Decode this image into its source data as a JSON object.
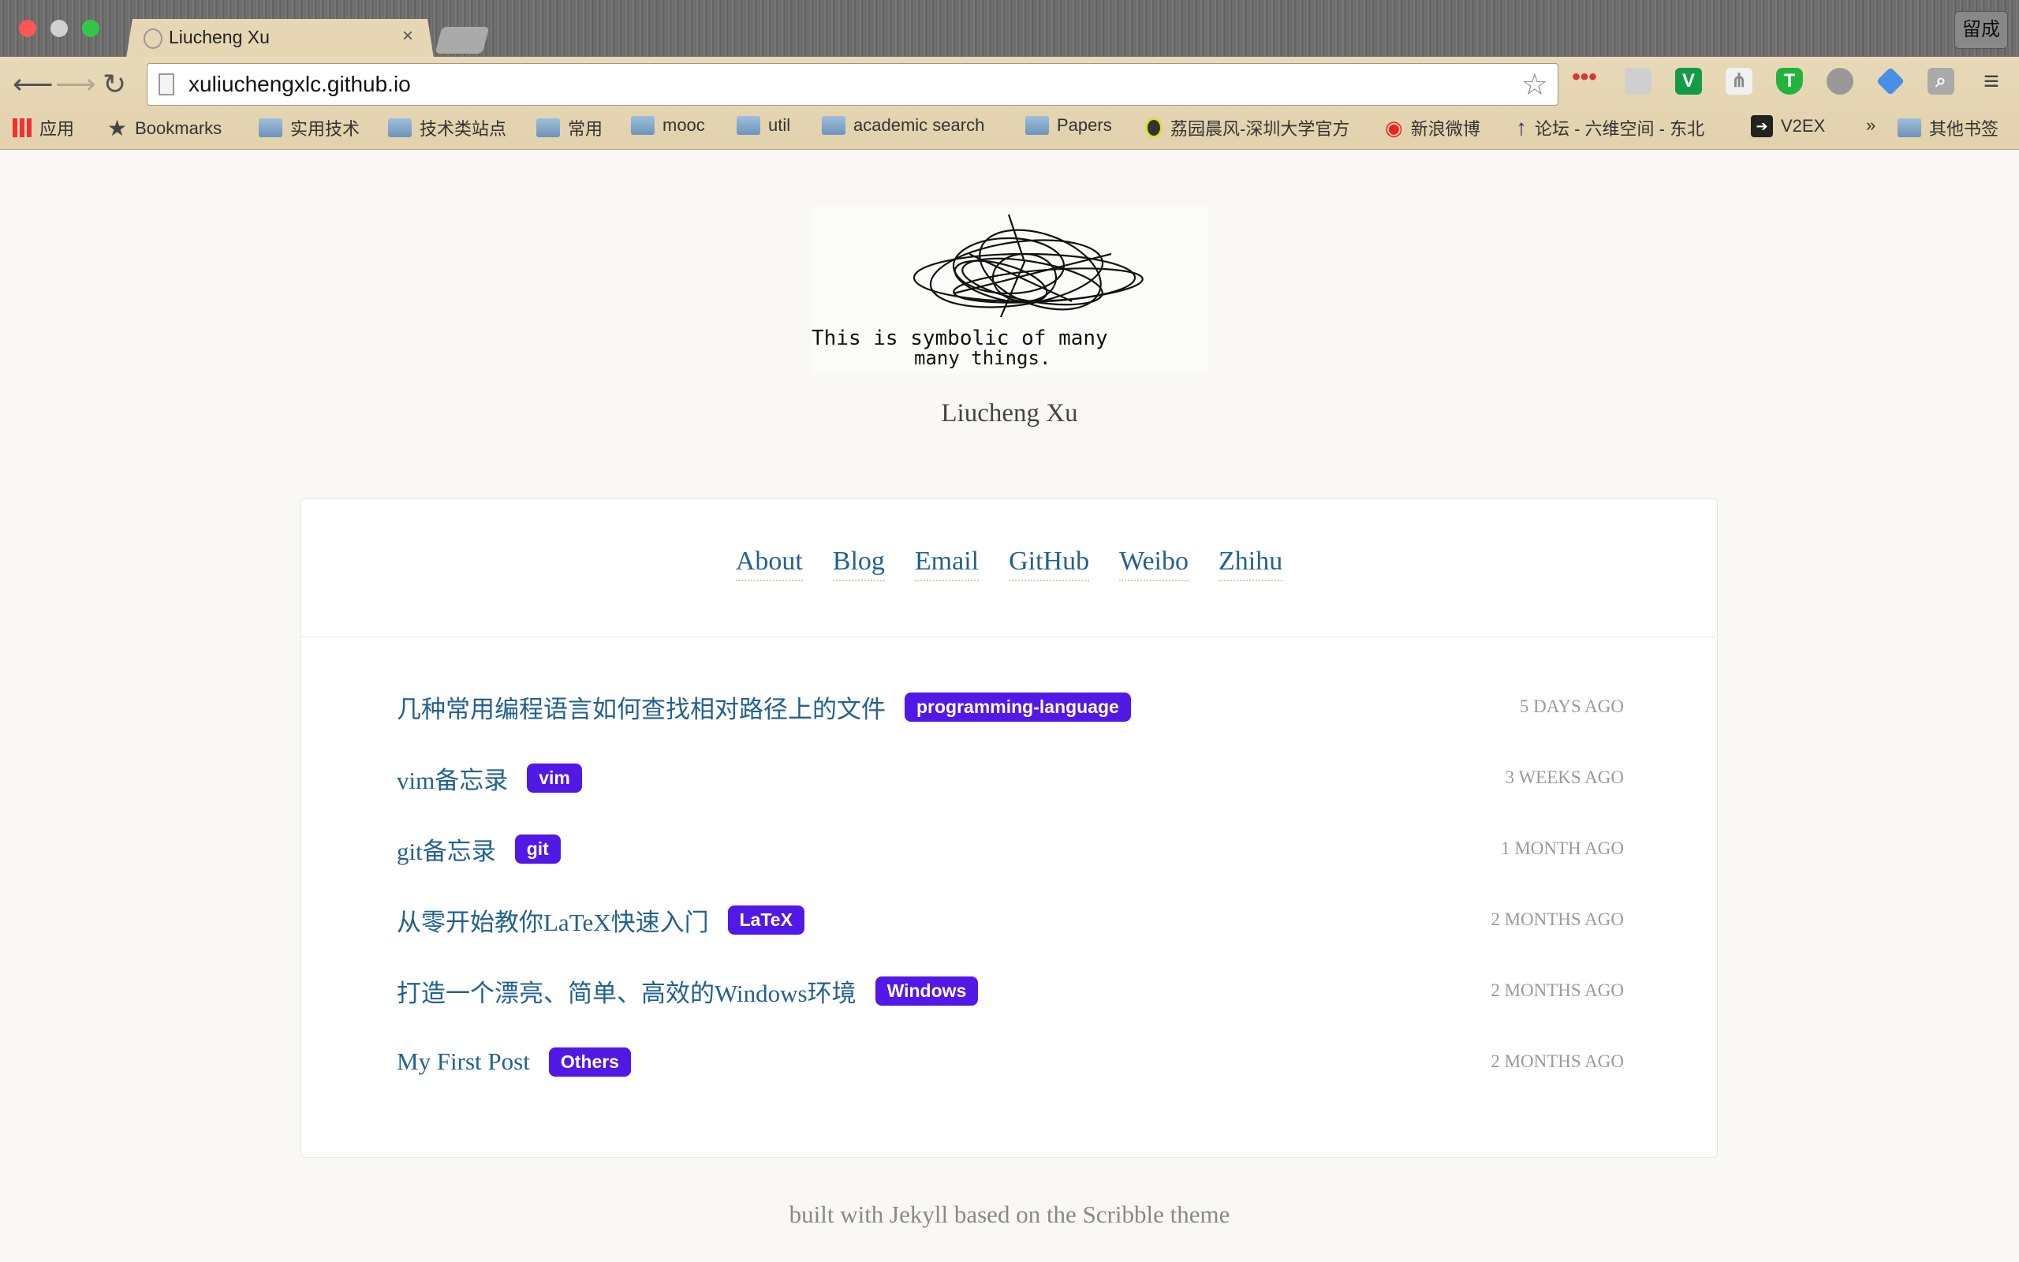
{
  "browser": {
    "tab_title": "Liucheng Xu",
    "tab_close": "×",
    "profile_label": "留成",
    "url": "xuliuchengxlc.github.io",
    "bookmarks": [
      "应用",
      "Bookmarks",
      "实用技术",
      "技术类站点",
      "常用",
      "mooc",
      "util",
      "academic search",
      "Papers",
      "荔园晨风-深圳大学官方",
      "新浪微博",
      "论坛 - 六维空间 - 东北",
      "V2EX",
      "»",
      "其他书签"
    ]
  },
  "site": {
    "logo_text": "This is symbolic of many many things.",
    "name": "Liucheng Xu",
    "nav": [
      "About",
      "Blog",
      "Email",
      "GitHub",
      "Weibo",
      "Zhihu"
    ],
    "posts": [
      {
        "title": "几种常用编程语言如何查找相对路径上的文件",
        "tag": "programming-language",
        "date": "5 days ago"
      },
      {
        "title": "vim备忘录",
        "tag": "vim",
        "date": "3 weeks ago"
      },
      {
        "title": "git备忘录",
        "tag": "git",
        "date": "1 month ago"
      },
      {
        "title": "从零开始教你LaTeX快速入门",
        "tag": "LaTeX",
        "date": "2 months ago"
      },
      {
        "title": "打造一个漂亮、简单、高效的Windows环境",
        "tag": "Windows",
        "date": "2 months ago"
      },
      {
        "title": "My First Post",
        "tag": "Others",
        "date": "2 months ago"
      }
    ],
    "footer": "built with Jekyll based on the Scribble theme"
  },
  "colors": {
    "link": "#23618f",
    "badge": "#5218e6",
    "date": "#9a9a9a"
  }
}
